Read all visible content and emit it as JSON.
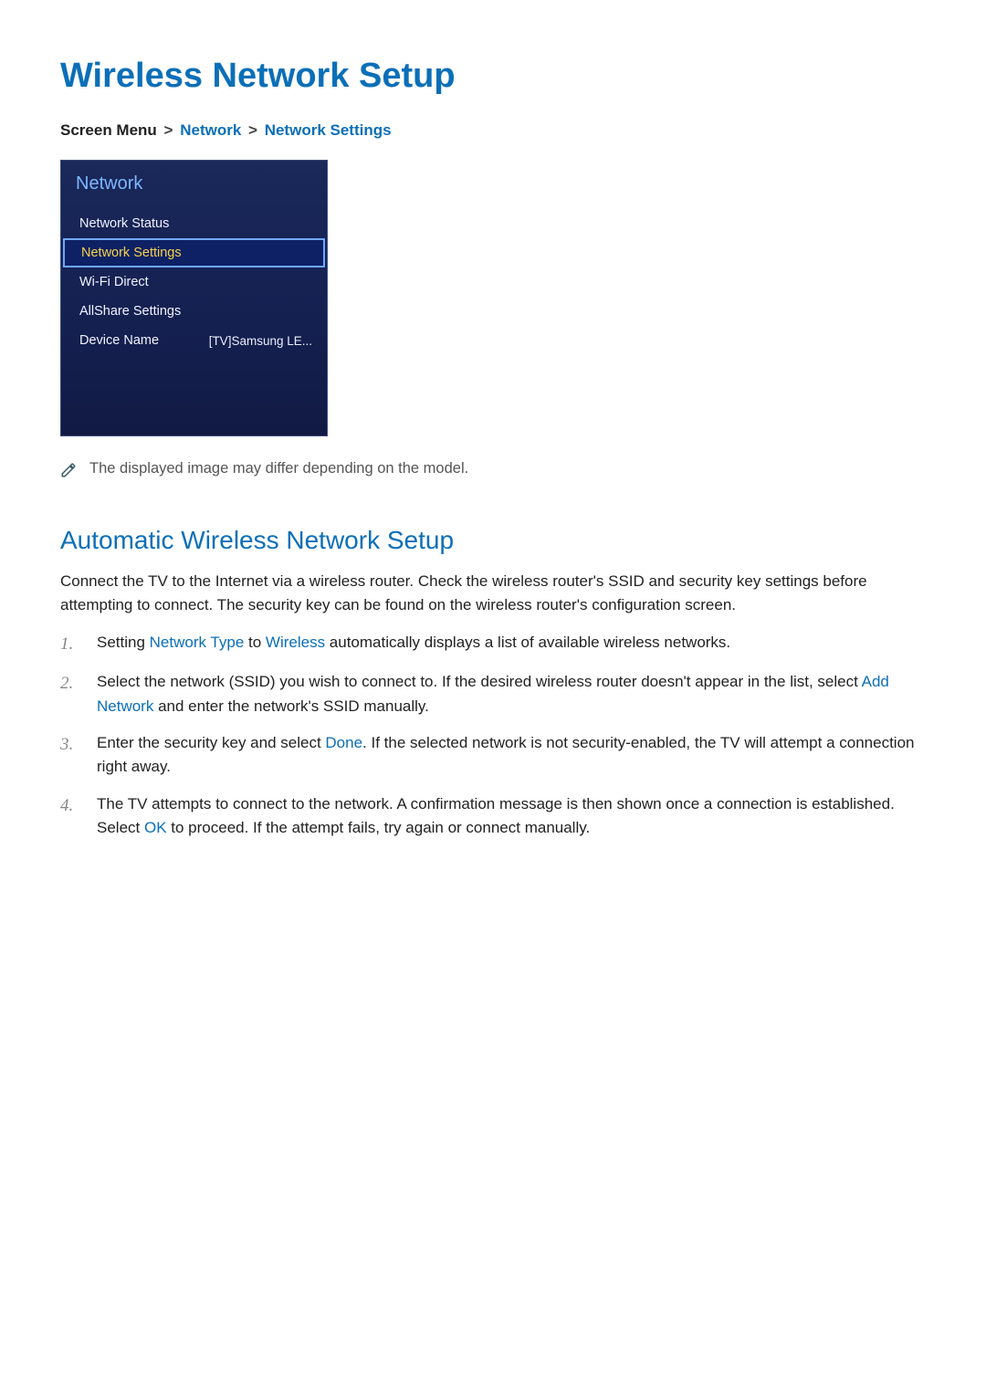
{
  "title": "Wireless Network Setup",
  "breadcrumb": {
    "prefix": "Screen Menu",
    "crumb1": "Network",
    "crumb2": "Network Settings",
    "sep": ">"
  },
  "menu": {
    "header": "Network",
    "items": [
      {
        "label": "Network Status",
        "value": "",
        "selected": false
      },
      {
        "label": "Network Settings",
        "value": "",
        "selected": true
      },
      {
        "label": "Wi-Fi Direct",
        "value": "",
        "selected": false
      },
      {
        "label": "AllShare Settings",
        "value": "",
        "selected": false
      },
      {
        "label": "Device Name",
        "value": "[TV]Samsung LE...",
        "selected": false
      }
    ]
  },
  "note": "The displayed image may differ depending on the model.",
  "section": {
    "title": "Automatic Wireless Network Setup",
    "intro": "Connect the TV to the Internet via a wireless router. Check the wireless router's SSID and security key settings before attempting to connect. The security key can be found on the wireless router's configuration screen.",
    "steps": [
      {
        "parts": [
          {
            "t": "Setting "
          },
          {
            "t": "Network Type",
            "hl": true
          },
          {
            "t": " to "
          },
          {
            "t": "Wireless",
            "hl": true
          },
          {
            "t": " automatically displays a list of available wireless networks."
          }
        ]
      },
      {
        "parts": [
          {
            "t": "Select the network (SSID) you wish to connect to. If the desired wireless router doesn't appear in the list, select "
          },
          {
            "t": "Add Network",
            "hl": true
          },
          {
            "t": " and enter the network's SSID manually."
          }
        ]
      },
      {
        "parts": [
          {
            "t": "Enter the security key and select "
          },
          {
            "t": "Done",
            "hl": true
          },
          {
            "t": ". If the selected network is not security-enabled, the TV will attempt a connection right away."
          }
        ]
      },
      {
        "parts": [
          {
            "t": "The TV attempts to connect to the network. A confirmation message is then shown once a connection is established. Select "
          },
          {
            "t": "OK",
            "hl": true
          },
          {
            "t": " to proceed. If the attempt fails, try again or connect manually."
          }
        ]
      }
    ]
  }
}
